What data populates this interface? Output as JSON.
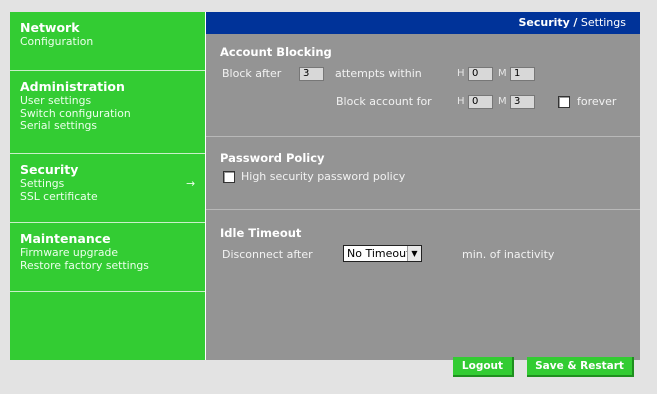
{
  "sidebar": {
    "sections": [
      {
        "title": "Network",
        "items": [
          "Configuration"
        ]
      },
      {
        "title": "Administration",
        "items": [
          "User settings",
          "Switch configuration",
          "Serial settings"
        ]
      },
      {
        "title": "Security",
        "items": [
          "Settings",
          "SSL certificate"
        ],
        "active_item_marker": "→"
      },
      {
        "title": "Maintenance",
        "items": [
          "Firmware upgrade",
          "Restore factory settings"
        ]
      }
    ]
  },
  "header": {
    "section": "Security",
    "separator": "/",
    "page": "Settings"
  },
  "account_blocking": {
    "title": "Account Blocking",
    "block_after_label": "Block after",
    "attempts_value": "3",
    "attempts_within_label": "attempts within",
    "within_h_label": "H",
    "within_h_value": "0",
    "within_m_label": "M",
    "within_m_value": "1",
    "block_account_for_label": "Block account for",
    "for_h_label": "H",
    "for_h_value": "0",
    "for_m_label": "M",
    "for_m_value": "3",
    "forever_label": "forever",
    "forever_checked": false
  },
  "password_policy": {
    "title": "Password Policy",
    "high_security_label": "High security password policy",
    "high_security_checked": false
  },
  "idle_timeout": {
    "title": "Idle Timeout",
    "disconnect_after_label": "Disconnect after",
    "selected": "No Timeout",
    "suffix": "min. of inactivity"
  },
  "buttons": {
    "logout": "Logout",
    "save_restart": "Save & Restart"
  },
  "colors": {
    "sidebar": "#33cc33",
    "header": "#003399",
    "panel": "#949494"
  }
}
